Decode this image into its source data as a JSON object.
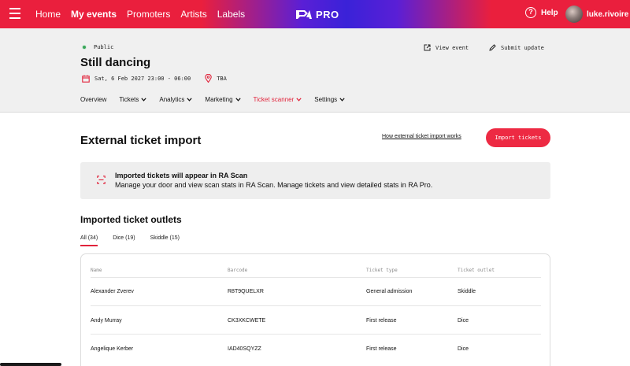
{
  "topbar": {
    "nav": [
      "Home",
      "My events",
      "Promoters",
      "Artists",
      "Labels"
    ],
    "active_nav": "My events",
    "logo_text": "PRO",
    "help_label": "Help",
    "username": "luke.rivoire"
  },
  "event": {
    "visibility": "Public",
    "title": "Still dancing",
    "date": "Sat, 6 Feb 2027  23:00 - 06:00",
    "location": "TBA",
    "view_event_label": "View event",
    "submit_update_label": "Submit update",
    "tabs": [
      "Overview",
      "Tickets",
      "Analytics",
      "Marketing",
      "Ticket scanner",
      "Settings"
    ],
    "active_tab": "Ticket scanner"
  },
  "main": {
    "title": "External ticket import",
    "how_link": "How external ticket import works",
    "import_button": "Import tickets",
    "banner_title": "Imported tickets will appear in RA Scan",
    "banner_text": "Manage your door and view scan stats in RA Scan. Manage tickets and view detailed stats in RA Pro.",
    "outlets_title": "Imported ticket outlets",
    "filters": [
      "All (34)",
      "Dice (19)",
      "Skiddle (15)"
    ],
    "active_filter": "All (34)"
  },
  "table": {
    "columns": [
      "Name",
      "Barcode",
      "Ticket type",
      "Ticket outlet"
    ],
    "rows": [
      {
        "name": "Alexander Zverev",
        "barcode": "R8T9QUELXR",
        "type": "General admission",
        "outlet": "Skiddle"
      },
      {
        "name": "Andy Murray",
        "barcode": "CK3XKCWETE",
        "type": "First release",
        "outlet": "Dice"
      },
      {
        "name": "Angelique Kerber",
        "barcode": "IAD40SQYZZ",
        "type": "First release",
        "outlet": "Dice"
      }
    ]
  },
  "colors": {
    "accent": "#ed2a43",
    "gradient_mid": "#3a22d8",
    "header_bg": "#f0f0f0",
    "public_dot": "#3aa55a"
  }
}
